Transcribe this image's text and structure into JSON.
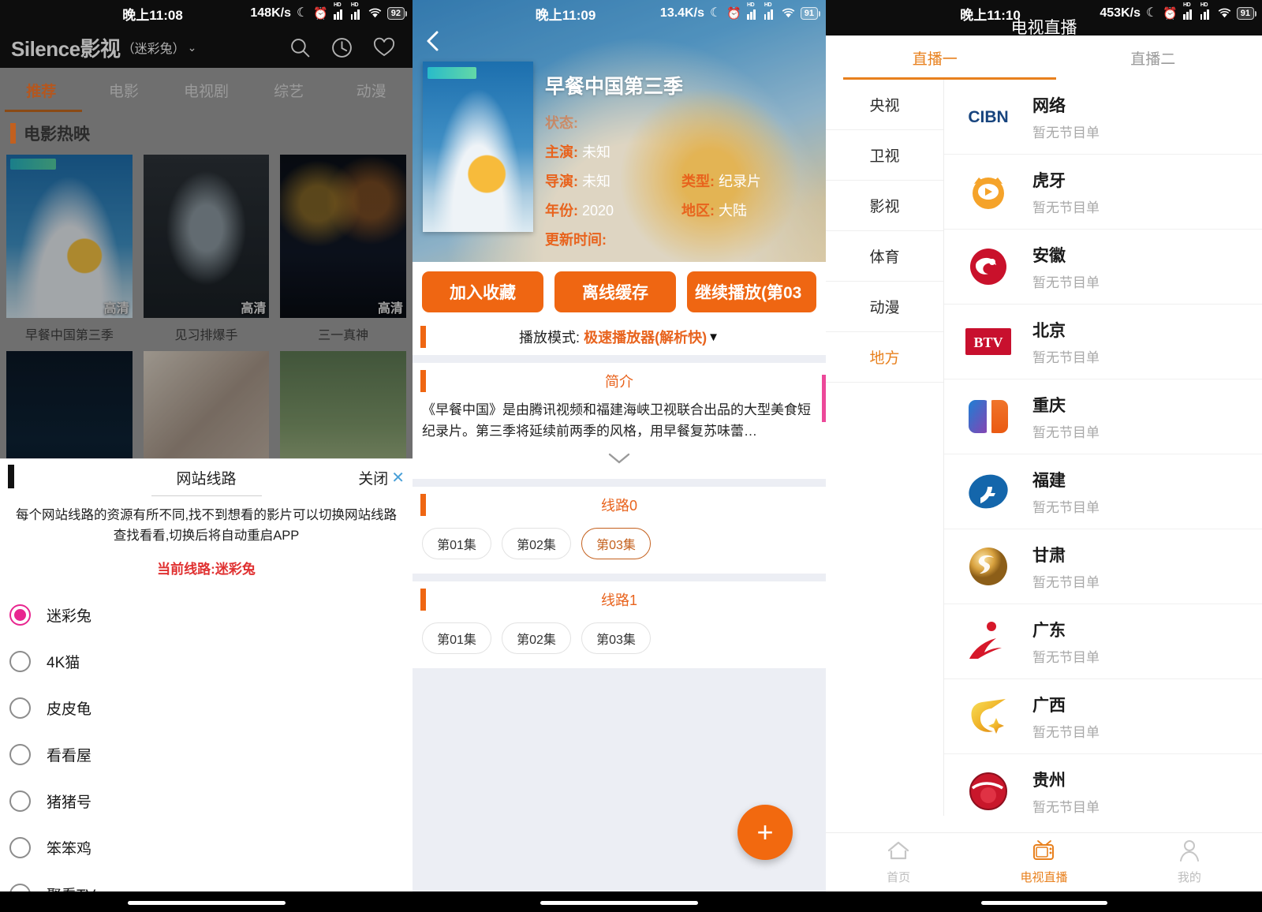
{
  "panel_left": {
    "status": {
      "time": "晚上11:08",
      "speed": "148K/s",
      "battery": "92"
    },
    "app": {
      "logo": "Silence影视",
      "source": "（迷彩兔）",
      "caret": "⌄"
    },
    "icons": {
      "search": "search-icon",
      "history": "history-icon",
      "favorite": "heart-icon"
    },
    "tabs": [
      {
        "label": "推荐",
        "active": true
      },
      {
        "label": "电影",
        "active": false
      },
      {
        "label": "电视剧",
        "active": false
      },
      {
        "label": "综艺",
        "active": false
      },
      {
        "label": "动漫",
        "active": false
      }
    ],
    "section_title": "电影热映",
    "quality_badge": "高清",
    "cards": [
      {
        "name": "早餐中国第三季",
        "style": "po-a"
      },
      {
        "name": "见习排爆手",
        "style": "po-b"
      },
      {
        "name": "三一真神",
        "style": "po-c"
      },
      {
        "name": "",
        "style": "po-d"
      },
      {
        "name": "",
        "style": "po-e"
      },
      {
        "name": "",
        "style": "po-f"
      }
    ],
    "dialog": {
      "title": "网站线路",
      "close_label": "关闭",
      "close_icon": "✕",
      "description": "每个网站线路的资源有所不同,找不到想看的影片可以切换网站线路查找看看,切换后将自动重启APP",
      "current_line": "当前线路:迷彩兔",
      "options": [
        {
          "label": "迷彩兔",
          "selected": true
        },
        {
          "label": "4K猫",
          "selected": false
        },
        {
          "label": "皮皮龟",
          "selected": false
        },
        {
          "label": "看看屋",
          "selected": false
        },
        {
          "label": "猪猪号",
          "selected": false
        },
        {
          "label": "笨笨鸡",
          "selected": false
        },
        {
          "label": "聚看TV",
          "selected": false
        }
      ]
    }
  },
  "panel_middle": {
    "status": {
      "time": "晚上11:09",
      "speed": "13.4K/s",
      "battery": "91"
    },
    "back_icon": "back-arrow-icon",
    "detail": {
      "title": "早餐中国第三季",
      "status_key": "状态:",
      "status_value": "",
      "cast_key": "主演:",
      "cast_value": "未知",
      "director_key": "导演:",
      "director_value": "未知",
      "genre_key": "类型:",
      "genre_value": "纪录片",
      "year_key": "年份:",
      "year_value": "2020",
      "region_key": "地区:",
      "region_value": "大陆",
      "updated_key": "更新时间:",
      "updated_value": ""
    },
    "buttons": {
      "favorite": "加入收藏",
      "download": "离线缓存",
      "continue": "继续播放(第03"
    },
    "play_mode": {
      "label": "播放模式:",
      "value": "极速播放器(解析快)",
      "arrow": "▼"
    },
    "synopsis": {
      "heading": "简介",
      "text": "《早餐中国》是由腾讯视频和福建海峡卫视联合出品的大型美食短纪录片。第三季将延续前两季的风格，用早餐复苏味蕾…",
      "expand_icon": "chevron-down-icon"
    },
    "lines": [
      {
        "heading": "线路0",
        "episodes": [
          {
            "label": "第01集",
            "selected": false
          },
          {
            "label": "第02集",
            "selected": false
          },
          {
            "label": "第03集",
            "selected": true
          }
        ]
      },
      {
        "heading": "线路1",
        "episodes": [
          {
            "label": "第01集",
            "selected": false
          },
          {
            "label": "第02集",
            "selected": false
          },
          {
            "label": "第03集",
            "selected": false
          }
        ]
      }
    ],
    "fab": "+"
  },
  "panel_right": {
    "status": {
      "time": "晚上11:10",
      "speed": "453K/s",
      "battery": "91"
    },
    "app_title": "电视直播",
    "tabs": [
      {
        "label": "直播一",
        "active": true
      },
      {
        "label": "直播二",
        "active": false
      }
    ],
    "categories": [
      {
        "label": "央视",
        "active": false
      },
      {
        "label": "卫视",
        "active": false
      },
      {
        "label": "影视",
        "active": false
      },
      {
        "label": "体育",
        "active": false
      },
      {
        "label": "动漫",
        "active": false
      },
      {
        "label": "地方",
        "active": true
      }
    ],
    "no_program": "暂无节目单",
    "channels": [
      {
        "name": "网络",
        "sub": "暂无节目单",
        "logo": "cibn-logo"
      },
      {
        "name": "虎牙",
        "sub": "暂无节目单",
        "logo": "huya-logo"
      },
      {
        "name": "安徽",
        "sub": "暂无节目单",
        "logo": "anhui-tv-logo"
      },
      {
        "name": "北京",
        "sub": "暂无节目单",
        "logo": "btv-logo"
      },
      {
        "name": "重庆",
        "sub": "暂无节目单",
        "logo": "chongqing-tv-logo"
      },
      {
        "name": "福建",
        "sub": "暂无节目单",
        "logo": "fujian-tv-logo"
      },
      {
        "name": "甘肃",
        "sub": "暂无节目单",
        "logo": "gansu-tv-logo"
      },
      {
        "name": "广东",
        "sub": "暂无节目单",
        "logo": "guangdong-tv-logo"
      },
      {
        "name": "广西",
        "sub": "暂无节目单",
        "logo": "guangxi-tv-logo"
      },
      {
        "name": "贵州",
        "sub": "暂无节目单",
        "logo": "guizhou-tv-logo"
      }
    ],
    "bottom_nav": [
      {
        "label": "首页",
        "icon": "home-icon",
        "active": false
      },
      {
        "label": "电视直播",
        "icon": "tv-icon",
        "active": true
      },
      {
        "label": "我的",
        "icon": "person-icon",
        "active": false
      }
    ]
  },
  "colors": {
    "accent": "#ef6612",
    "orange_text": "#e8801d",
    "pink": "#e8268f",
    "red": "#e03131"
  }
}
